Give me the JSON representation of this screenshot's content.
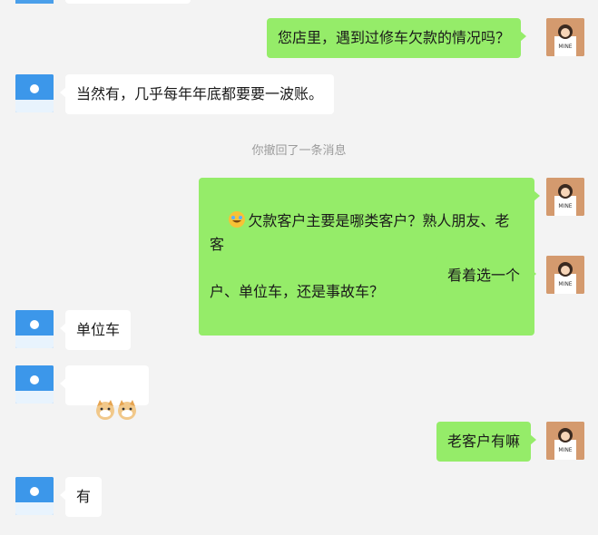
{
  "messages": [
    {
      "side": "self",
      "text": "您店里，遇到过修车欠款的情况吗？"
    },
    {
      "side": "other",
      "text": "当然有，几乎每年年底都要要一波账。"
    },
    {
      "system": "你撤回了一条消息"
    },
    {
      "side": "self",
      "text_line1": "欠款客户主要是哪类客户？熟人朋友、老客",
      "text_line2": "户、单位车，还是事故车？"
    },
    {
      "side": "self",
      "text": "看着选一个"
    },
    {
      "side": "other",
      "text": "单位车"
    },
    {
      "side": "other",
      "emoji": "doge-doge"
    },
    {
      "side": "self",
      "text": "老客户有嘛"
    },
    {
      "side": "other",
      "text": "有"
    }
  ],
  "colors": {
    "self_bubble": "#95ec69",
    "other_bubble": "#ffffff",
    "background": "#f3f3f3"
  },
  "avatars": {
    "self": "cartoon-girl-avatar-icon",
    "other": "sky-sun-avatar-icon"
  }
}
